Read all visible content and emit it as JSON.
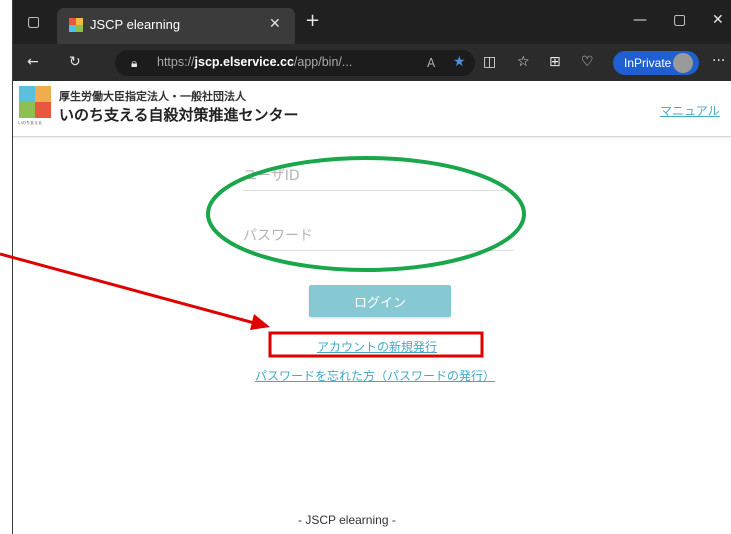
{
  "browser": {
    "tab_title": "JSCP elearning",
    "url_prefix": "https://",
    "url_domain": "jscp.elservice.cc",
    "url_path": "/app/bin/...",
    "inprivate_label": "InPrivate",
    "accent_color": "#1f5fd0"
  },
  "site": {
    "org_line1": "厚生労働大臣指定法人・一般社団法人",
    "org_line2": "いのち支える自殺対策推進センター",
    "manual_link": "マニュアル",
    "logo_caption": "いのち支える"
  },
  "login": {
    "user_id_placeholder": "ユーザID",
    "password_placeholder": "パスワード",
    "login_button": "ログイン",
    "new_account_link": "アカウントの新規発行",
    "forgot_password_link": "パスワードを忘れた方（パスワードの発行）",
    "button_color": "#87c9d2",
    "link_color": "#46a9c6"
  },
  "footer": {
    "text": "- JSCP elearning -"
  },
  "annotations": {
    "ellipse_color": "#1aa64a",
    "highlight_box_color": "#e00000",
    "arrow_color": "#e00000"
  }
}
